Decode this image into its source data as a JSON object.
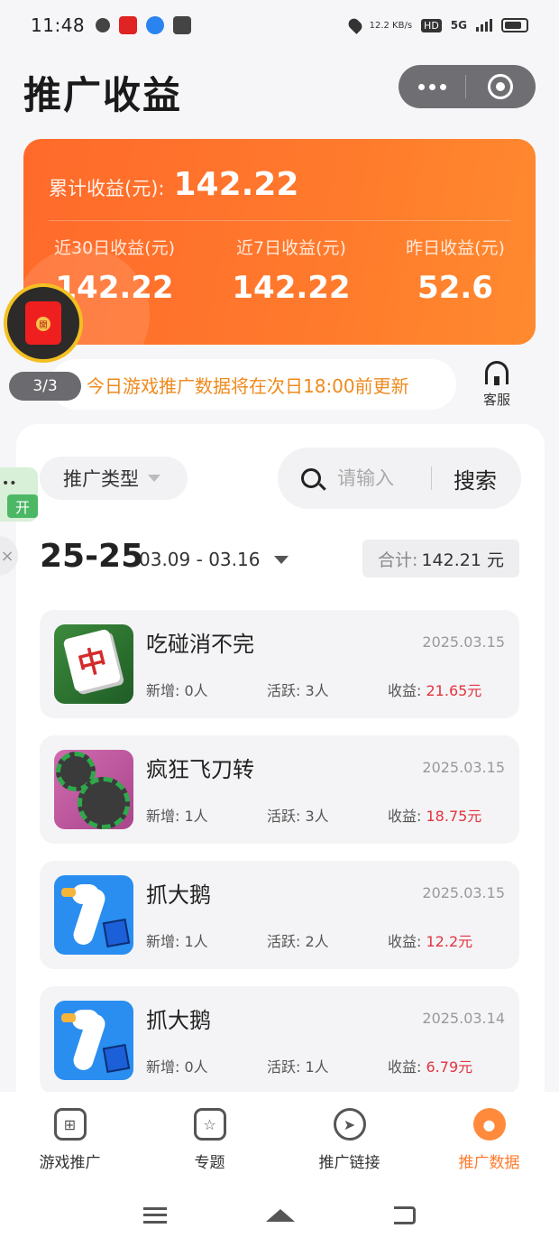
{
  "status_bar": {
    "time": "11:48",
    "net_speed": "12.2 KB/s",
    "network": "5G"
  },
  "header": {
    "title": "推广收益"
  },
  "earnings": {
    "total_label": "累计收益(元):",
    "total_value": "142.22",
    "stats": [
      {
        "label": "近30日收益(元)",
        "value": "142.22"
      },
      {
        "label": "近7日收益(元)",
        "value": "142.22"
      },
      {
        "label": "昨日收益(元)",
        "value": "52.6"
      }
    ]
  },
  "red_packet": {
    "glyph": "開",
    "page_count": "3/3"
  },
  "notice": {
    "text": "今日游戏推广数据将在次日18:00前更新",
    "service_label": "客服"
  },
  "side_widget": {
    "label": "开",
    "close": "×"
  },
  "filters": {
    "type_label": "推广类型",
    "search_placeholder": "请输入",
    "search_button": "搜索"
  },
  "range": {
    "year": "25-25",
    "dates": "03.09 - 03.16",
    "sum_label": "合计:",
    "sum_value": "142.21 元"
  },
  "games": [
    {
      "name": "吃碰消不完",
      "date": "2025.03.15",
      "new": "新增: 0人",
      "active": "活跃: 3人",
      "earn_label": "收益:",
      "earn_value": "21.65元",
      "icon": "mahjong-icon"
    },
    {
      "name": "疯狂飞刀转",
      "date": "2025.03.15",
      "new": "新增: 1人",
      "active": "活跃: 3人",
      "earn_label": "收益:",
      "earn_value": "18.75元",
      "icon": "knife-game-icon"
    },
    {
      "name": "抓大鹅",
      "date": "2025.03.15",
      "new": "新增: 1人",
      "active": "活跃: 2人",
      "earn_label": "收益:",
      "earn_value": "12.2元",
      "icon": "goose-game-icon"
    },
    {
      "name": "抓大鹅",
      "date": "2025.03.14",
      "new": "新增: 0人",
      "active": "活跃: 1人",
      "earn_label": "收益:",
      "earn_value": "6.79元",
      "icon": "goose-game-icon"
    }
  ],
  "tabs": [
    {
      "label": "游戏推广",
      "icon": "gamepad-icon",
      "active": false
    },
    {
      "label": "专题",
      "icon": "star-icon",
      "active": false
    },
    {
      "label": "推广链接",
      "icon": "send-icon",
      "active": false
    },
    {
      "label": "推广数据",
      "icon": "data-icon",
      "active": true
    }
  ],
  "colors": {
    "accent": "#ff7a2c",
    "earnings_red": "#e2343f"
  }
}
